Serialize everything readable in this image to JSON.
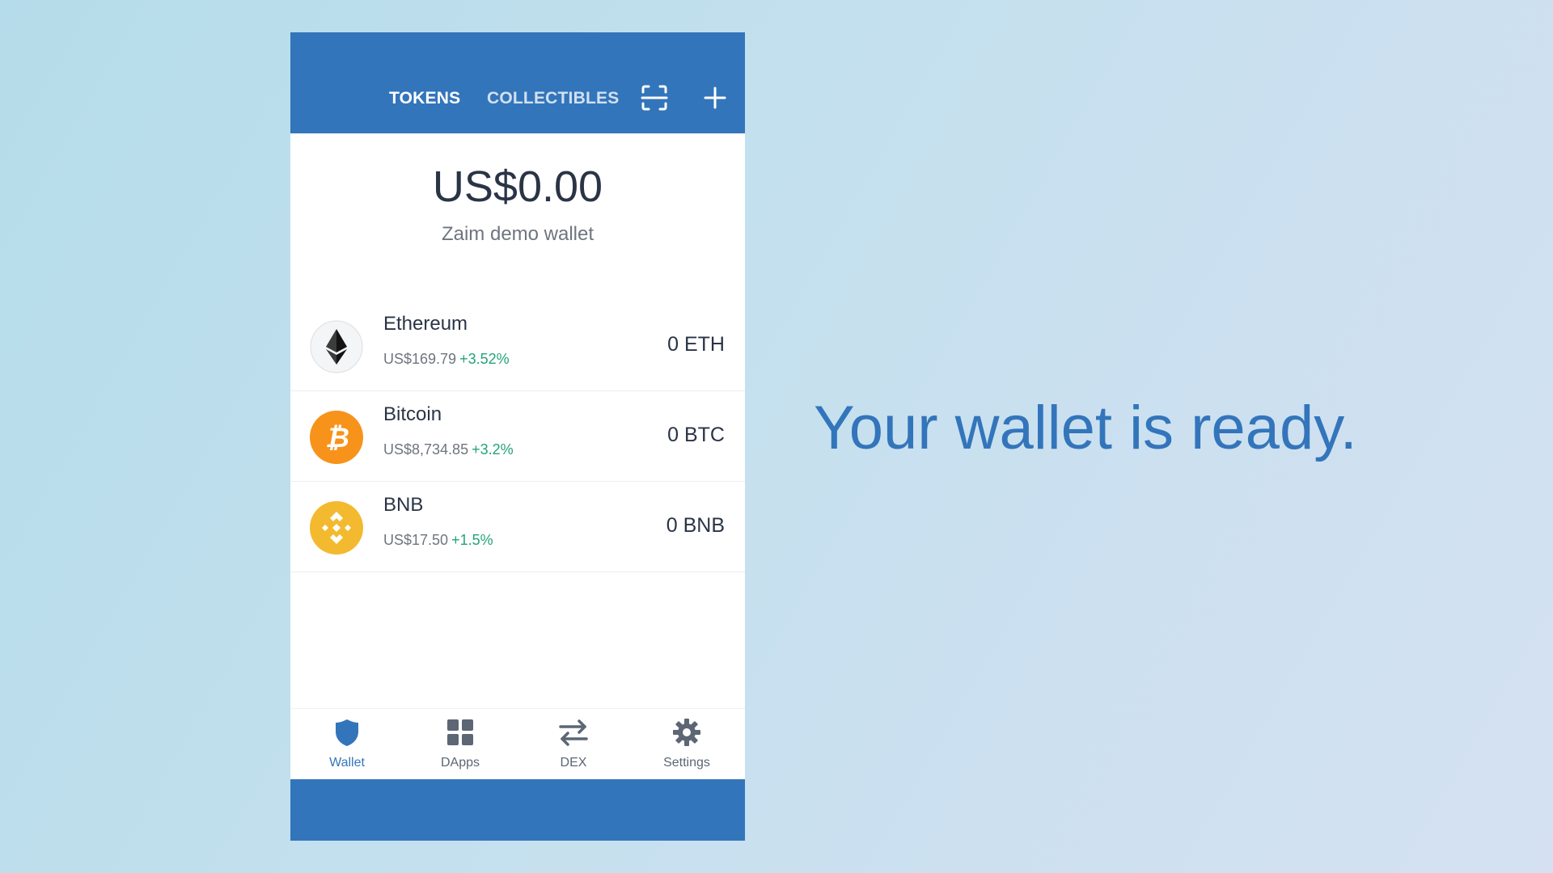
{
  "header": {
    "tabs": [
      {
        "label": "TOKENS",
        "active": true
      },
      {
        "label": "COLLECTIBLES",
        "active": false
      }
    ],
    "scan_icon": "scan-icon",
    "add_icon": "plus-icon"
  },
  "summary": {
    "balance": "US$0.00",
    "wallet_name": "Zaim demo wallet"
  },
  "tokens": [
    {
      "name": "Ethereum",
      "price": "US$169.79",
      "change": "+3.52%",
      "amount": "0 ETH",
      "icon": "ethereum-icon"
    },
    {
      "name": "Bitcoin",
      "price": "US$8,734.85",
      "change": "+3.2%",
      "amount": "0 BTC",
      "icon": "bitcoin-icon"
    },
    {
      "name": "BNB",
      "price": "US$17.50",
      "change": "+1.5%",
      "amount": "0 BNB",
      "icon": "bnb-icon"
    }
  ],
  "nav": [
    {
      "label": "Wallet",
      "icon": "shield-icon",
      "active": true
    },
    {
      "label": "DApps",
      "icon": "grid-icon",
      "active": false
    },
    {
      "label": "DEX",
      "icon": "swap-arrows-icon",
      "active": false
    },
    {
      "label": "Settings",
      "icon": "gear-icon",
      "active": false
    }
  ],
  "headline": "Your wallet is ready.",
  "colors": {
    "brand_blue": "#3375bb",
    "positive_change": "#24a37a",
    "bitcoin_orange": "#f7931a",
    "bnb_yellow": "#f3ba2f"
  }
}
